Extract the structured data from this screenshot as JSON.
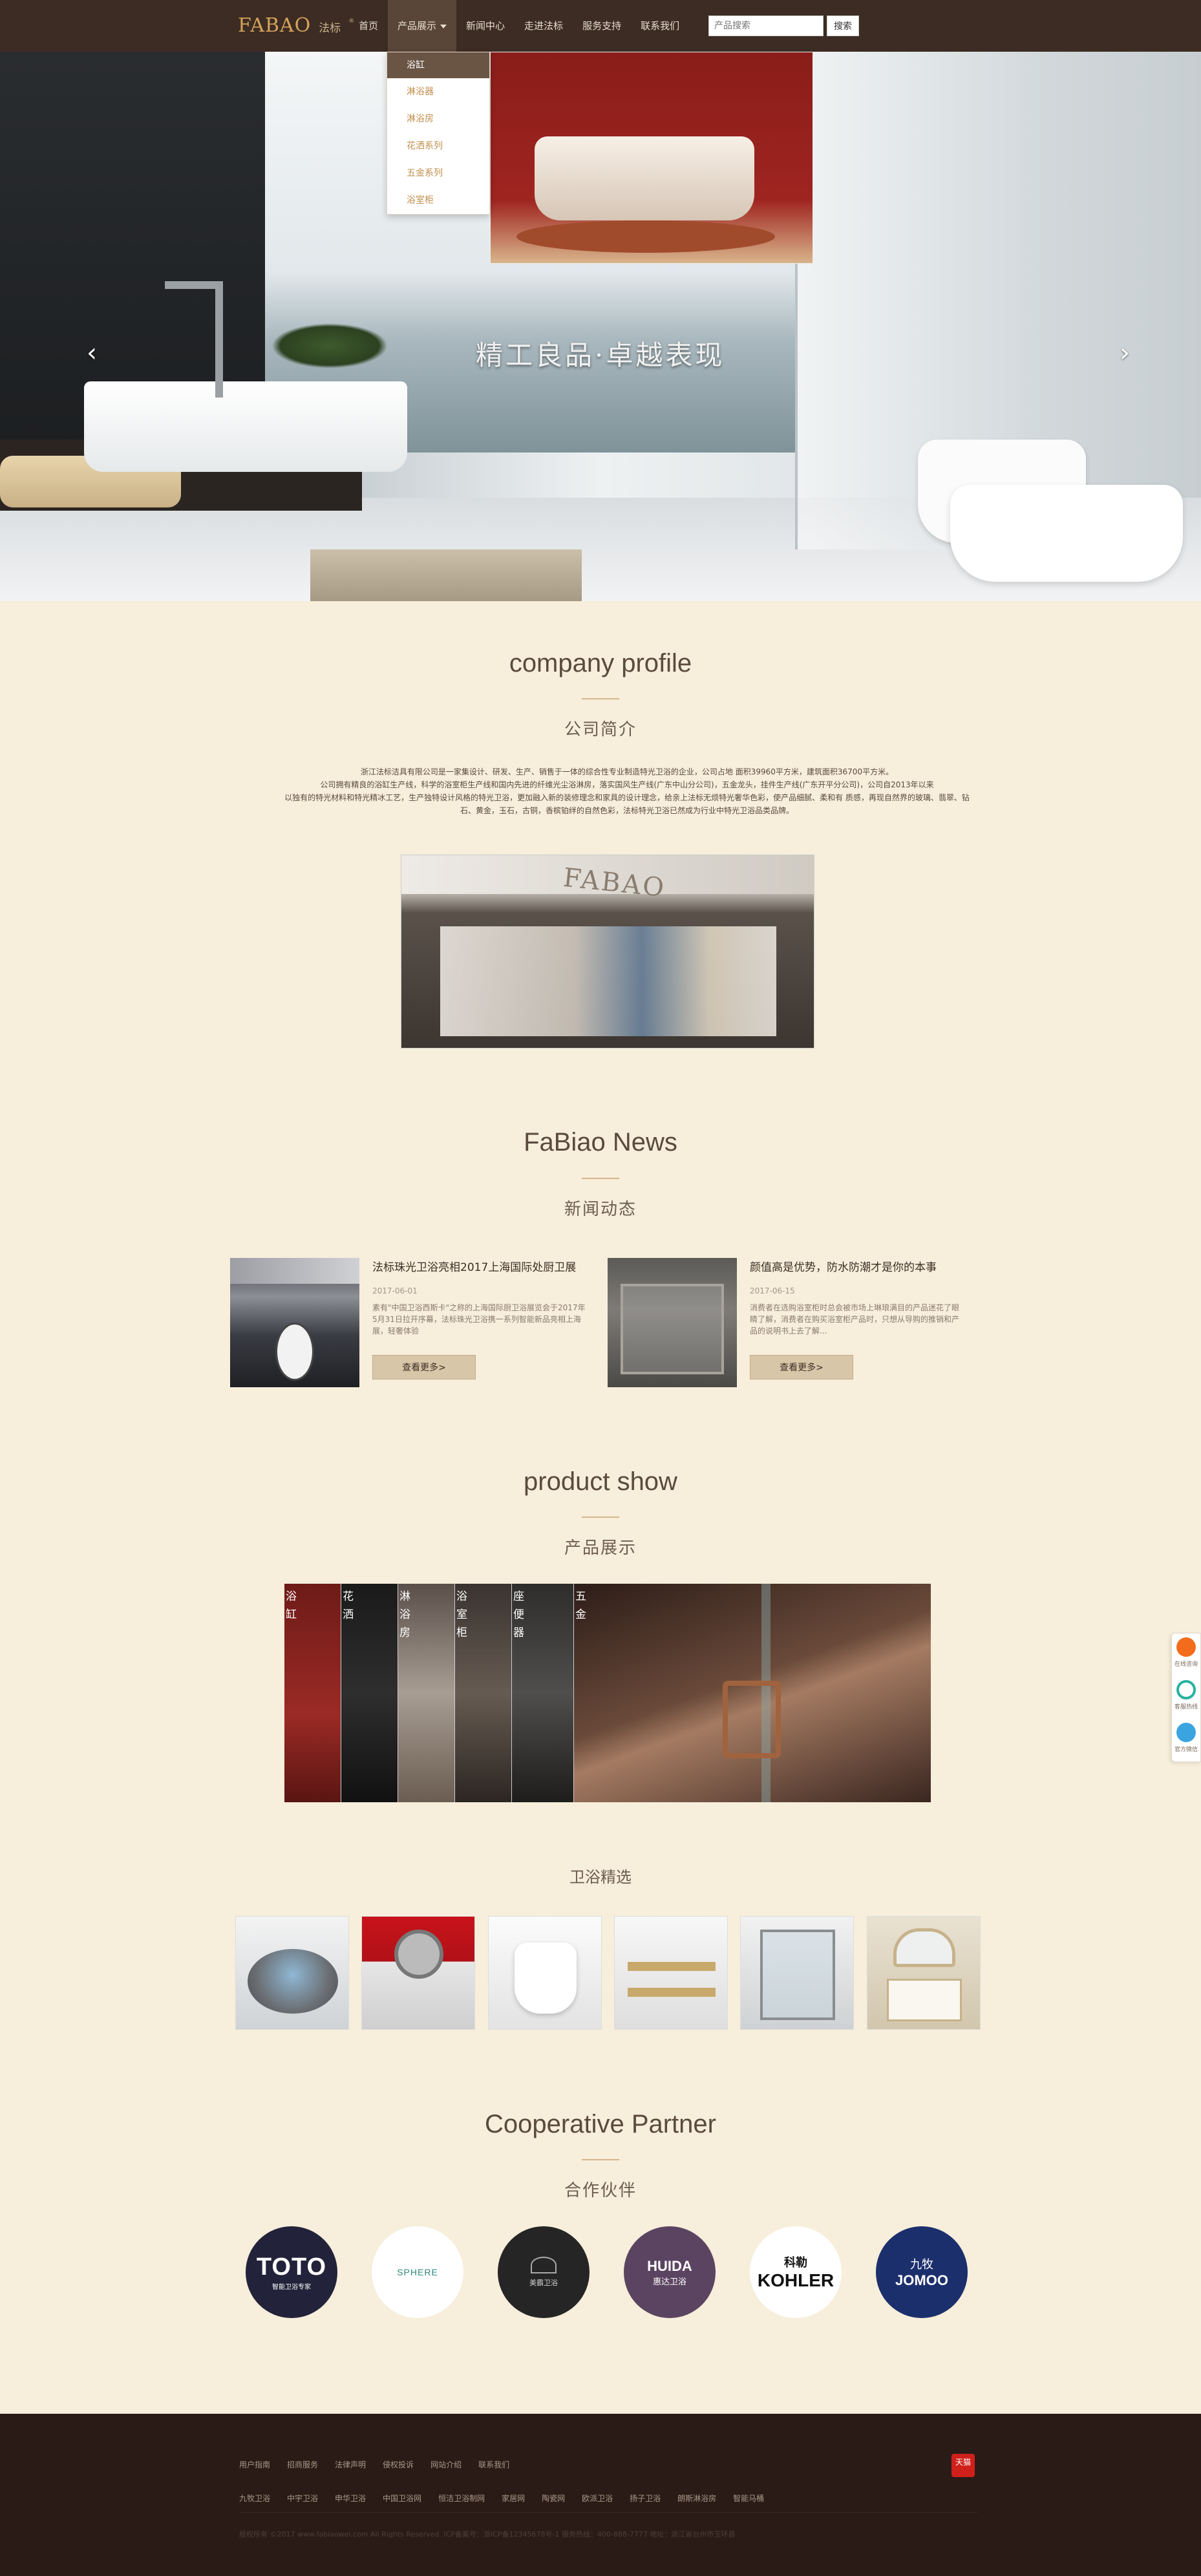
{
  "header": {
    "logo_brand": "FABAO",
    "logo_cn": "法标",
    "logo_mark": "®",
    "nav": [
      {
        "label": "首页"
      },
      {
        "label": "产品展示"
      },
      {
        "label": "新闻中心"
      },
      {
        "label": "走进法标"
      },
      {
        "label": "服务支持"
      },
      {
        "label": "联系我们"
      }
    ],
    "search_placeholder": "产品搜索",
    "search_button": "搜索"
  },
  "dropdown": {
    "items": [
      "浴缸",
      "淋浴器",
      "淋浴房",
      "花洒系列",
      "五金系列",
      "浴室柜"
    ]
  },
  "hero": {
    "slogan": "精工良品·卓越表现",
    "prev": "‹",
    "next": "›",
    "slide_count": 2,
    "active_slide": 2
  },
  "profile": {
    "title_en": "company profile",
    "title_cn": "公司简介",
    "lines": [
      "浙江法标洁具有限公司是一家集设计、研发、生产、销售于一体的综合性专业制造特光卫浴的企业，公司占地 面积39960平方米，建筑面积36700平方米。",
      "公司拥有精良的浴缸生产线，科学的浴室柜生产线和国内先进的纤维光尘浴淋房，落实国风生产线(广东中山分公司)，五金龙头，挂件生产线(广东开平分公司)，公司自2013年以来",
      "以独有的特光材料和特光精冰工艺，生产独特设计风格的特光卫浴，更加融入新的装修理念和家具的设计理念，给亲上法标无烦特光奢华色彩，使产品细腻、柔和有 质感，再现自然界的玻璃、翡翠、钻",
      "石、黄金，玉石，古铜，香槟铂绊的自然色彩，法标特光卫浴已然成为行业中特光卫浴品类品牌。"
    ]
  },
  "news": {
    "title_en": "FaBiao News",
    "title_cn": "新闻动态",
    "items": [
      {
        "title": "法标珠光卫浴亮相2017上海国际处厨卫展",
        "date": "2017-06-01",
        "desc": "素有\"中国卫浴西斯卡\"之称的上海国际厨卫浴展览会于2017年5月31日拉开序幕，法标珠光卫浴携一系列智能新品亮相上海展，轻奢体验",
        "more": "查看更多>"
      },
      {
        "title": "颜值高是优势，防水防潮才是你的本事",
        "date": "2017-06-15",
        "desc": "消费者在选购浴室柜时总会被市场上琳琅满目的产品迷花了眼睛了解，消费者在购买浴室柜产品时，只想从导购的推销和产品的说明书上去了解...",
        "more": "查看更多>"
      }
    ]
  },
  "product": {
    "title_en": "product show",
    "title_cn": "产品展示",
    "columns": [
      "浴缸",
      "花洒",
      "淋浴房",
      "浴室柜",
      "座便器",
      "五金"
    ]
  },
  "picks": {
    "title": "卫浴精选",
    "items": [
      "按摩浴缸",
      "花洒",
      "智能马桶",
      "置物架",
      "淋浴房",
      "浴室柜"
    ]
  },
  "partners": {
    "title_en": "Cooperative Partner",
    "title_cn": "合作伙伴",
    "items": [
      {
        "name": "TOTO",
        "sub": "智能卫浴专家",
        "bg": "#22223a",
        "fg": "#ffffff"
      },
      {
        "name": "SPHERE",
        "sub": "",
        "bg": "#ffffff",
        "fg": "#2f8a7a"
      },
      {
        "name": "美霸卫浴",
        "sub": "",
        "bg": "#252525",
        "fg": "#cfcfcf"
      },
      {
        "name": "HUIDA",
        "sub": "惠达卫浴",
        "bg": "#5b4461",
        "fg": "#ffffff"
      },
      {
        "name": "KOHLER",
        "sub": "科勒",
        "bg": "#ffffff",
        "fg": "#111111"
      },
      {
        "name": "JOMOO",
        "sub": "九牧",
        "bg": "#1c2f6d",
        "fg": "#ffffff"
      }
    ]
  },
  "footer": {
    "links1": [
      "用户指南",
      "招商服务",
      "法律声明",
      "侵权投诉",
      "网站介绍",
      "联系我们"
    ],
    "links2": [
      "九牧卫浴",
      "中宇卫浴",
      "申华卫浴",
      "中国卫浴网",
      "恒洁卫浴制网",
      "家居网",
      "陶瓷网",
      "欧派卫浴",
      "扬子卫浴",
      "朗斯淋浴房",
      "智能马桶"
    ],
    "copyright": "版权所有 ©2017 www.fabiaowei.com All Rights Reserved.    ICP备案号：浙ICP备12345678号-1    服务热线：400-888-7777    地址：浙江省台州市玉环县",
    "tmall_label": "天猫"
  },
  "side": [
    "在线咨询",
    "客服热线",
    "官方微信"
  ],
  "colors": {
    "header_bg": "#3c2c23",
    "page_bg": "#f7eedb",
    "footer_bg": "#2a1b17",
    "accent": "#d6a35c"
  }
}
